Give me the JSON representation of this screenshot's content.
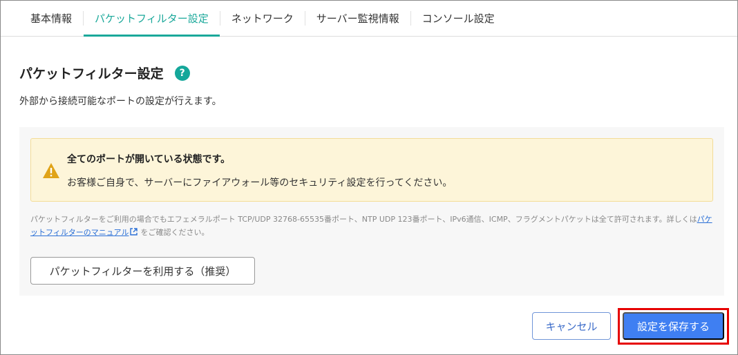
{
  "tabs": [
    {
      "label": "基本情報",
      "active": false
    },
    {
      "label": "パケットフィルター設定",
      "active": true
    },
    {
      "label": "ネットワーク",
      "active": false
    },
    {
      "label": "サーバー監視情報",
      "active": false
    },
    {
      "label": "コンソール設定",
      "active": false
    }
  ],
  "section": {
    "title": "パケットフィルター設定",
    "help_icon": "?",
    "description": "外部から接続可能なポートの設定が行えます。"
  },
  "alert": {
    "icon": "warning-triangle-icon",
    "title": "全てのポートが開いている状態です。",
    "body": "お客様ご自身で、サーバーにファイアウォール等のセキュリティ設定を行ってください。"
  },
  "note": {
    "text_before": "パケットフィルターをご利用の場合でもエフェメラルポート TCP/UDP 32768-65535番ポート、NTP UDP 123番ポート、IPv6通信、ICMP、フラグメントパケットは全て許可されます。詳しくは",
    "link_text": "パケットフィルターのマニュアル",
    "text_after": "をご確認ください。"
  },
  "enable_button": "パケットフィルターを利用する（推奨）",
  "footer": {
    "cancel": "キャンセル",
    "save": "設定を保存する"
  },
  "colors": {
    "accent": "#1aa89a",
    "primary_button": "#3f7ff2",
    "highlight": "#e60000",
    "alert_bg": "#fdf5d9"
  }
}
